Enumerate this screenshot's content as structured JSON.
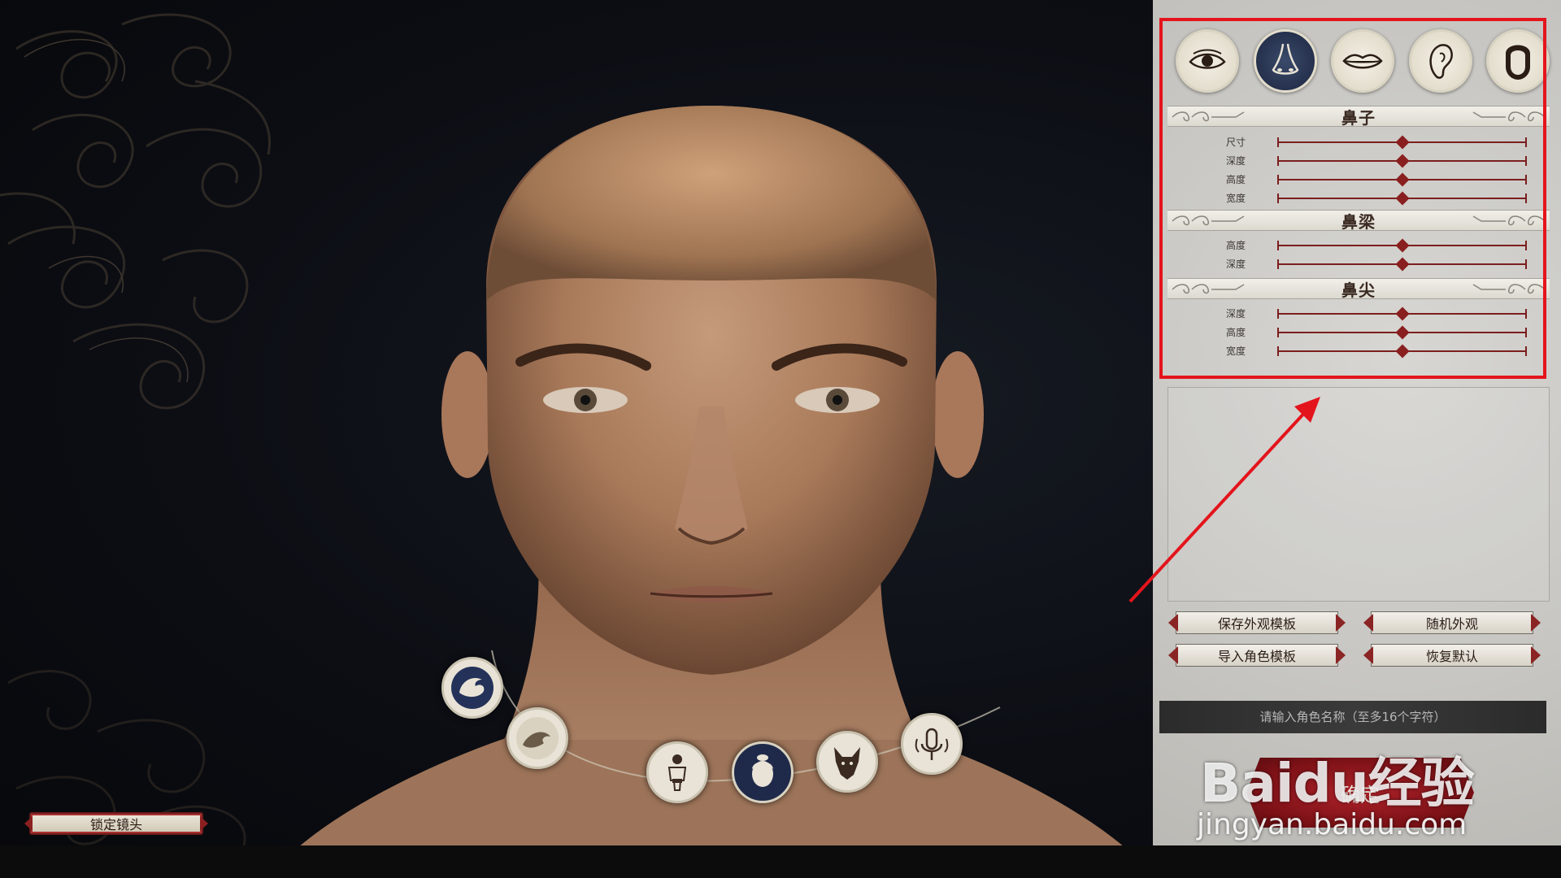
{
  "left": {
    "lock_camera": "锁定镜头"
  },
  "wheel": [
    {
      "name": "dragon-icon",
      "active": false
    },
    {
      "name": "wave-icon",
      "active": false
    },
    {
      "name": "body-icon",
      "active": false
    },
    {
      "name": "head-icon",
      "active": true
    },
    {
      "name": "wolf-icon",
      "active": false
    },
    {
      "name": "voice-icon",
      "active": false
    }
  ],
  "panel": {
    "feature_tabs": [
      {
        "name": "eye-icon",
        "active": false
      },
      {
        "name": "nose-icon",
        "active": true
      },
      {
        "name": "lips-icon",
        "active": false
      },
      {
        "name": "ear-icon",
        "active": false
      },
      {
        "name": "face-shape-icon",
        "active": false
      }
    ],
    "sections": [
      {
        "title": "鼻子",
        "sliders": [
          {
            "label": "尺寸",
            "value": 0.5
          },
          {
            "label": "深度",
            "value": 0.5
          },
          {
            "label": "高度",
            "value": 0.5
          },
          {
            "label": "宽度",
            "value": 0.5
          }
        ]
      },
      {
        "title": "鼻梁",
        "sliders": [
          {
            "label": "高度",
            "value": 0.5
          },
          {
            "label": "深度",
            "value": 0.5
          }
        ]
      },
      {
        "title": "鼻尖",
        "sliders": [
          {
            "label": "深度",
            "value": 0.5
          },
          {
            "label": "高度",
            "value": 0.5
          },
          {
            "label": "宽度",
            "value": 0.5
          }
        ]
      }
    ],
    "buttons": {
      "save_template": "保存外观模板",
      "random_look": "随机外观",
      "import_template": "导入角色模板",
      "restore_default": "恢复默认"
    },
    "name_placeholder": "请输入角色名称（至多16个字符）",
    "confirm": "确定"
  },
  "watermark": {
    "main": "Baidu经验",
    "sub": "jingyan.baidu.com"
  },
  "colors": {
    "accent_red": "#8a1f1f",
    "annotation_red": "#e4141c",
    "active_tab": "#1f2a4a"
  }
}
